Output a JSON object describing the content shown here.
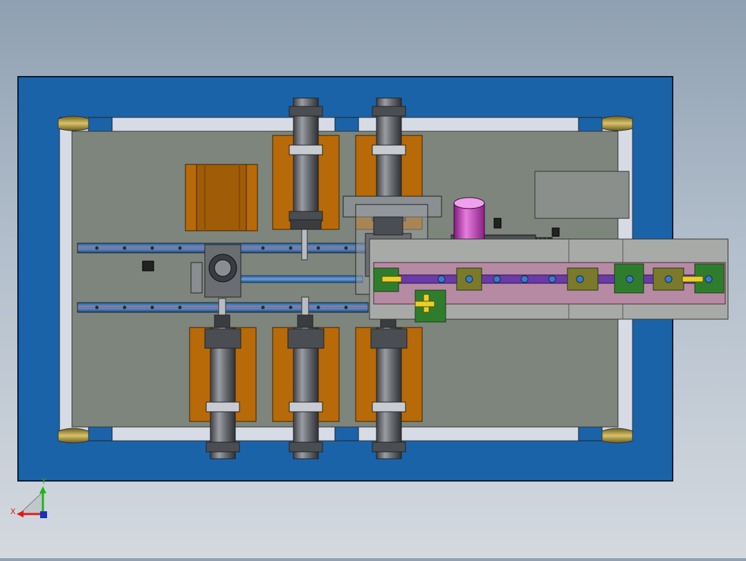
{
  "viewport": {
    "type": "cad-3d-viewport",
    "view": "top",
    "background_colors": [
      "#8fa0b2",
      "#d4d9df"
    ]
  },
  "palette": {
    "frame_blue": "#1a63a8",
    "rail_white": "#d6dbe6",
    "plate_gray": "#7d857c",
    "cylinder_gray": "#6b6e73",
    "mount_orange": "#b86a08",
    "motor_magenta": "#c236b4",
    "carriage_pink": "#b78aa3",
    "linkage_purple": "#6a3aa8",
    "clamp_green": "#2f7d2c",
    "accent_yellow": "#e8d02a",
    "foot_gold": "#c9b25a"
  },
  "triad": {
    "x_label": "X",
    "y_label": "Y",
    "x_color": "#e01818",
    "y_color": "#18b818"
  }
}
